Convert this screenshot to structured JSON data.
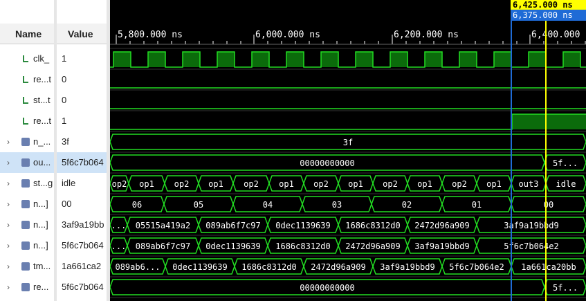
{
  "header": {
    "name": "Name",
    "value": "Value"
  },
  "signals": [
    {
      "name": "clk_",
      "value": "1",
      "kind": "bit"
    },
    {
      "name": "re...t",
      "value": "0",
      "kind": "bit"
    },
    {
      "name": "st...t",
      "value": "0",
      "kind": "bit"
    },
    {
      "name": "re...t",
      "value": "1",
      "kind": "bit"
    },
    {
      "name": "n_...",
      "value": "3f",
      "kind": "bus"
    },
    {
      "name": "ou...",
      "value": "5f6c7b064",
      "kind": "bus"
    },
    {
      "name": "st...g",
      "value": "idle",
      "kind": "bus"
    },
    {
      "name": "n...]",
      "value": "00",
      "kind": "bus"
    },
    {
      "name": "n...]",
      "value": "3af9a19bb",
      "kind": "bus"
    },
    {
      "name": "n...]",
      "value": "5f6c7b064",
      "kind": "bus"
    },
    {
      "name": "tm...",
      "value": "1a661ca2",
      "kind": "bus"
    },
    {
      "name": "re...",
      "value": "5f6c7b064",
      "kind": "bus"
    }
  ],
  "timeline": {
    "ticks": [
      "5,800.000 ns",
      "6,000.000 ns",
      "6,200.000 ns",
      "6,400.000 ns"
    ],
    "cursor_yellow": "6,425.000 ns",
    "cursor_blue": "6,375.000 ns"
  },
  "waves": {
    "n_": [
      {
        "label": "3f"
      }
    ],
    "ou": [
      {
        "label": "00000000000"
      },
      {
        "label": "5f..."
      }
    ],
    "state": [
      "op2",
      "op1",
      "op2",
      "op1",
      "op2",
      "op1",
      "op2",
      "op1",
      "op2",
      "op1",
      "op2",
      "op1",
      "out3",
      "idle"
    ],
    "n1": [
      "06",
      "05",
      "04",
      "03",
      "02",
      "01",
      "00"
    ],
    "n2": [
      "...",
      "05515a419a2",
      "089ab6f7c97",
      "0dec1139639",
      "1686c8312d0",
      "2472d96a909",
      "3af9a19bbd9"
    ],
    "n3": [
      "...",
      "089ab6f7c97",
      "0dec1139639",
      "1686c8312d0",
      "2472d96a909",
      "3af9a19bbd9",
      "5f6c7b064e2"
    ],
    "tm": [
      "089ab6...",
      "0dec1139639",
      "1686c8312d0",
      "2472d96a909",
      "3af9a19bbd9",
      "5f6c7b064e2",
      "1a661ca20bb"
    ],
    "re": [
      {
        "label": "00000000000"
      },
      {
        "label": "5f..."
      }
    ]
  },
  "colors": {
    "wave": "#22dd22",
    "fill": "#0b6b0b",
    "cursor_yellow": "#ffff00",
    "cursor_blue": "#1f6bd6"
  }
}
